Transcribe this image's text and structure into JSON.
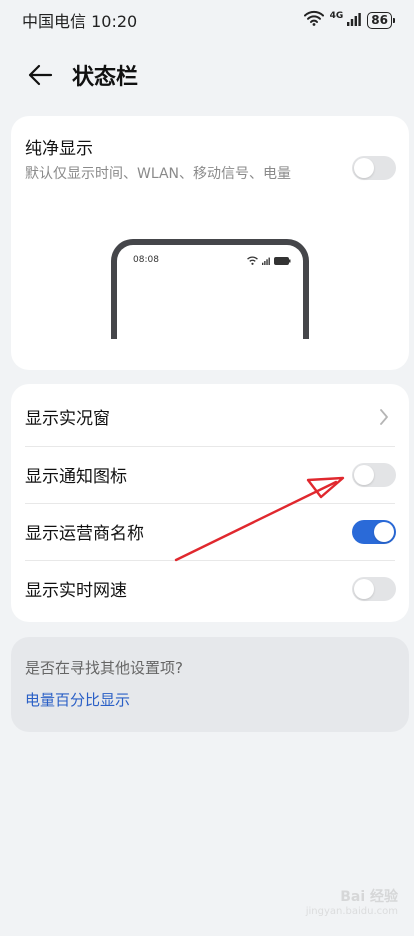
{
  "status_bar": {
    "carrier_time": "中国电信 10:20",
    "network": "4G",
    "battery": "86"
  },
  "header": {
    "title": "状态栏"
  },
  "pure_display": {
    "title": "纯净显示",
    "description": "默认仅显示时间、WLAN、移动信号、电量",
    "enabled": false,
    "preview_time": "08:08"
  },
  "settings": [
    {
      "label": "显示实况窗",
      "control": "chevron"
    },
    {
      "label": "显示通知图标",
      "control": "toggle",
      "enabled": false
    },
    {
      "label": "显示运营商名称",
      "control": "toggle",
      "enabled": true
    },
    {
      "label": "显示实时网速",
      "control": "toggle",
      "enabled": false
    }
  ],
  "suggestion": {
    "question": "是否在寻找其他设置项?",
    "link": "电量百分比显示"
  },
  "watermark": {
    "name": "Bai 经验",
    "url": "jingyan.baidu.com"
  },
  "colors": {
    "accent": "#2a6ad8",
    "annotation_arrow": "#e0282e",
    "link": "#2a5fc6"
  }
}
